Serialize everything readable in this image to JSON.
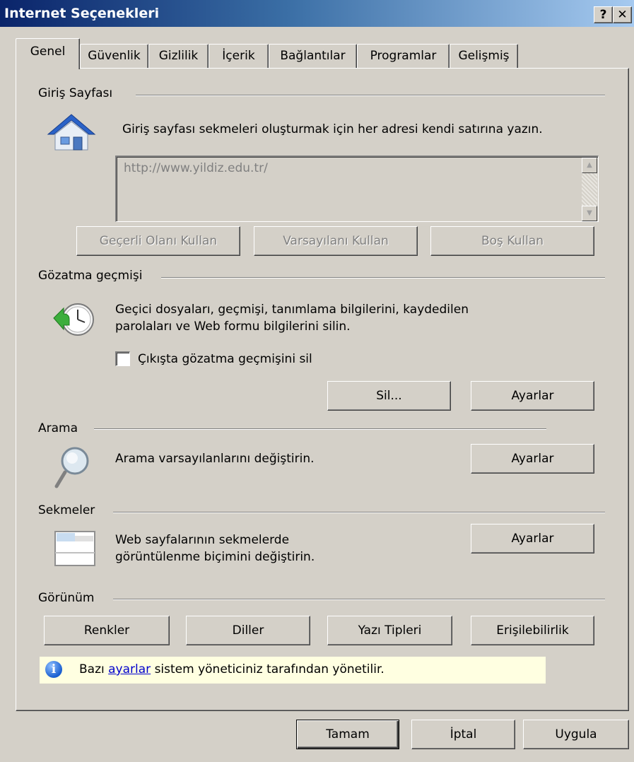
{
  "window": {
    "title": "Internet Seçenekleri",
    "help_label": "?",
    "close_label": "✕"
  },
  "tabs": [
    {
      "label": "Genel",
      "active": true
    },
    {
      "label": "Güvenlik"
    },
    {
      "label": "Gizlilik"
    },
    {
      "label": "İçerik"
    },
    {
      "label": "Bağlantılar"
    },
    {
      "label": "Programlar"
    },
    {
      "label": "Gelişmiş"
    }
  ],
  "home": {
    "heading": "Giriş Sayfası",
    "description": "Giriş sayfası sekmeleri oluşturmak için her adresi kendi satırına yazın.",
    "url_value": "http://www.yildiz.edu.tr/",
    "use_current": "Geçerli Olanı Kullan",
    "use_default": "Varsayılanı Kullan",
    "use_blank": "Boş Kullan",
    "icon": "house-icon"
  },
  "history": {
    "heading": "Gözatma geçmişi",
    "description_line1": "Geçici dosyaları, geçmişi, tanımlama bilgilerini, kaydedilen",
    "description_line2": "parolaları ve Web formu bilgilerini silin.",
    "checkbox_label": "Çıkışta gözatma geçmişini sil",
    "checkbox_checked": false,
    "delete_label": "Sil...",
    "settings_label": "Ayarlar",
    "icon": "history-clock-icon"
  },
  "search": {
    "heading": "Arama",
    "description": "Arama varsayılanlarını değiştirin.",
    "settings_label": "Ayarlar",
    "icon": "magnifier-icon"
  },
  "tabs_section": {
    "heading": "Sekmeler",
    "description_line1": "Web sayfalarının sekmelerde",
    "description_line2": "görüntülenme biçimini değiştirin.",
    "settings_label": "Ayarlar",
    "icon": "tabs-window-icon"
  },
  "appearance": {
    "heading": "Görünüm",
    "colors": "Renkler",
    "languages": "Diller",
    "fonts": "Yazı Tipleri",
    "accessibility": "Erişilebilirlik"
  },
  "info": {
    "prefix": "Bazı",
    "link": "ayarlar",
    "suffix": "sistem yöneticiniz tarafından yönetilir.",
    "icon": "info-icon",
    "icon_glyph": "i"
  },
  "footer": {
    "ok": "Tamam",
    "cancel": "İptal",
    "apply": "Uygula"
  }
}
